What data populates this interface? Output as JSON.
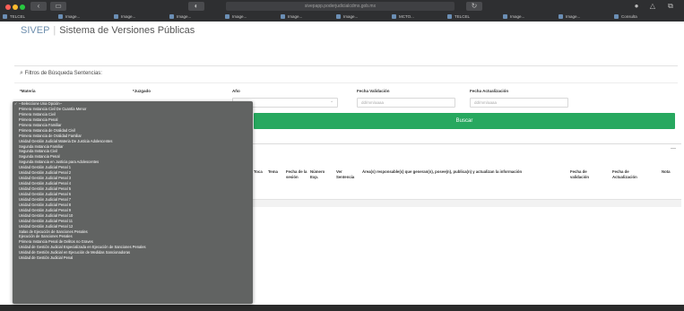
{
  "browser": {
    "address": "sivepapp.poderjudicialcdmx.gob.mx",
    "tabs": [
      {
        "label": "TELCEL"
      },
      {
        "label": "Image..."
      },
      {
        "label": "Image..."
      },
      {
        "label": "Image..."
      },
      {
        "label": "Image..."
      },
      {
        "label": "Image..."
      },
      {
        "label": "Image..."
      },
      {
        "label": "MCTO..."
      },
      {
        "label": "TELCEL"
      },
      {
        "label": "Image..."
      },
      {
        "label": "Image..."
      },
      {
        "label": "Consulta"
      }
    ]
  },
  "header": {
    "brand": "SIVEP",
    "title": "Sistema de Versiones Públicas"
  },
  "filters": {
    "title": "Filtros de Búsqueda Sentencias:",
    "materia_label": "*Materia",
    "juzgado_label": "*Juzgado",
    "anio_label": "Año",
    "fecha_validacion_label": "Fecha Validación",
    "fecha_actualizacion_label": "Fecha Actualización",
    "fecha_validacion_placeholder": "dd/mm/aaaa",
    "fecha_actualizacion_placeholder": "dd/mm/aaaa",
    "buscar_label": "Buscar"
  },
  "table": {
    "headers": [
      "Toca",
      "Tema",
      "Fecha de la sesión",
      "Número Exp.",
      "Ver Sentencia",
      "Área(s) responsable(s) que generan(n), posee(n), publica(n) y actualizan la información",
      "Fecha de validación",
      "Fecha de Actualización",
      "Nota"
    ],
    "collapse_symbol": "—"
  },
  "dropdown": {
    "selected": "--Seleccione Una Opción--",
    "options": [
      "--Seleccione Una Opción--",
      "Primera Instancia Civil De Cuantía Menor",
      "Primera Instancia Civil",
      "Primera Instancia Penal",
      "Primera Instancia Familiar",
      "Primera Instancia de Oralidad Civil",
      "Primera Instancia de Oralidad Familiar",
      "Unidad Gestión Judicial Materia De Justicia Adolescentes",
      "Segunda Instancia Familiar",
      "Segunda Instancia Civil",
      "Segunda Instancia Penal",
      "Segunda Instancia en Justicia para Adolescentes",
      "Unidad Gestión Judicial Penal 1",
      "Unidad Gestión Judicial Penal 2",
      "Unidad Gestión Judicial Penal 3",
      "Unidad Gestión Judicial Penal 4",
      "Unidad Gestión Judicial Penal 5",
      "Unidad Gestión Judicial Penal 6",
      "Unidad Gestión Judicial Penal 7",
      "Unidad Gestión Judicial Penal 8",
      "Unidad Gestión Judicial Penal 9",
      "Unidad Gestión Judicial Penal 10",
      "Unidad Gestión Judicial Penal 11",
      "Unidad Gestión Judicial Penal 12",
      "Salas de Ejecución de Sanciones Penales",
      "Ejecución de Sanciones Penales",
      "Primera Instancia Penal de Delitos no Graves",
      "Unidad de Gestión Judicial Especializada en Ejecución de Sanciones Penales",
      "Unidad de Gestión Judicial en Ejecución de Medidas Sancionadoras",
      "Unidad de Gestión Judicial Penal"
    ]
  },
  "colors": {
    "accent_green": "#27a85f",
    "brand_blue": "#6e8fae",
    "dropdown_bg": "#616362"
  }
}
